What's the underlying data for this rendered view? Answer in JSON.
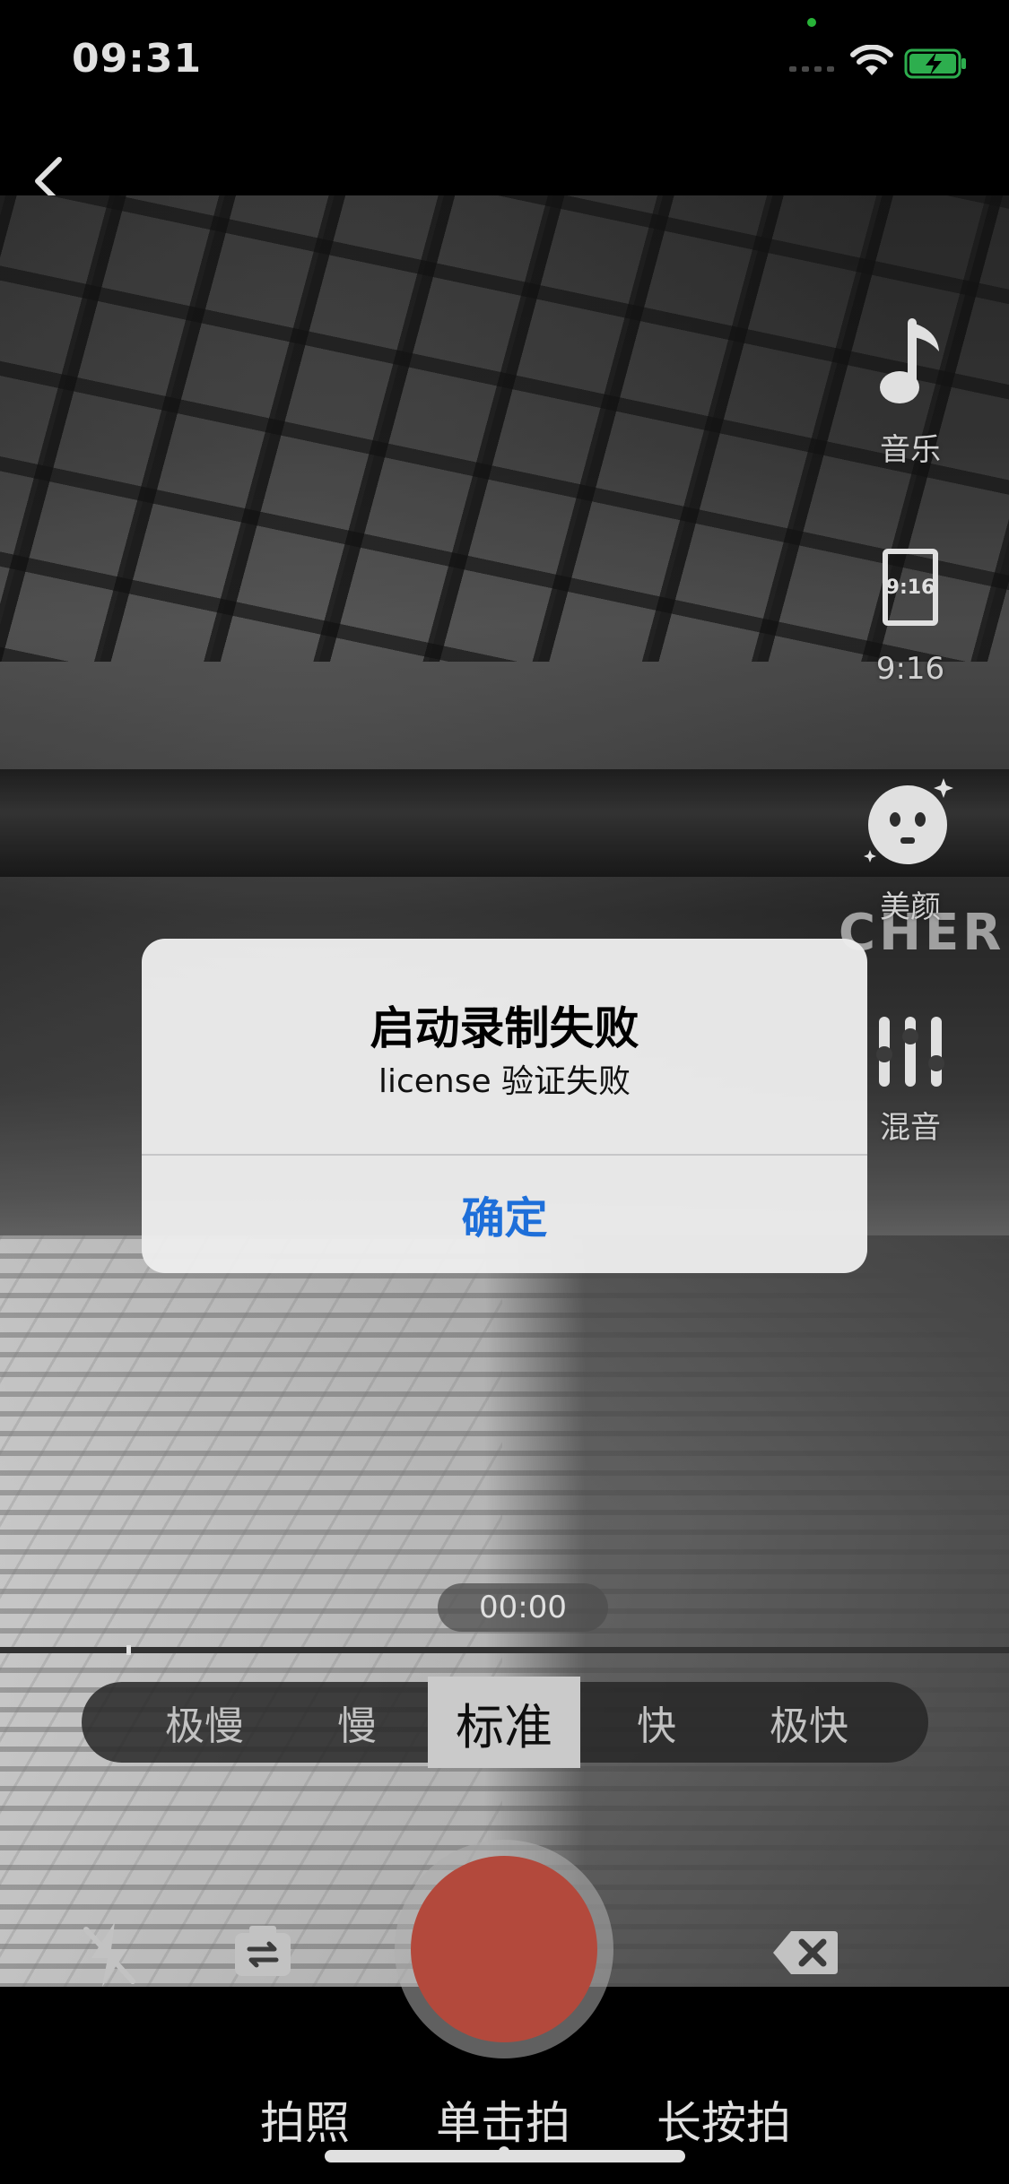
{
  "status_bar": {
    "time": "09:31"
  },
  "tools": {
    "music_label": "音乐",
    "ratio_icon_text": "9:16",
    "ratio_label": "9:16",
    "beauty_label": "美颜",
    "mix_label": "混音"
  },
  "preview": {
    "brand_text": "CHERR"
  },
  "alert": {
    "title": "启动录制失败",
    "message": "license 验证失败",
    "ok_label": "确定"
  },
  "timer": "00:00",
  "speed_options": [
    "极慢",
    "慢",
    "标准",
    "快",
    "极快"
  ],
  "speed_selected": "标准",
  "modes": [
    "拍照",
    "单击拍",
    "长按拍"
  ],
  "mode_selected": "单击拍",
  "colors": {
    "record_button": "#cc5445",
    "alert_button": "#1e6fd9",
    "battery_green": "#34c759"
  }
}
